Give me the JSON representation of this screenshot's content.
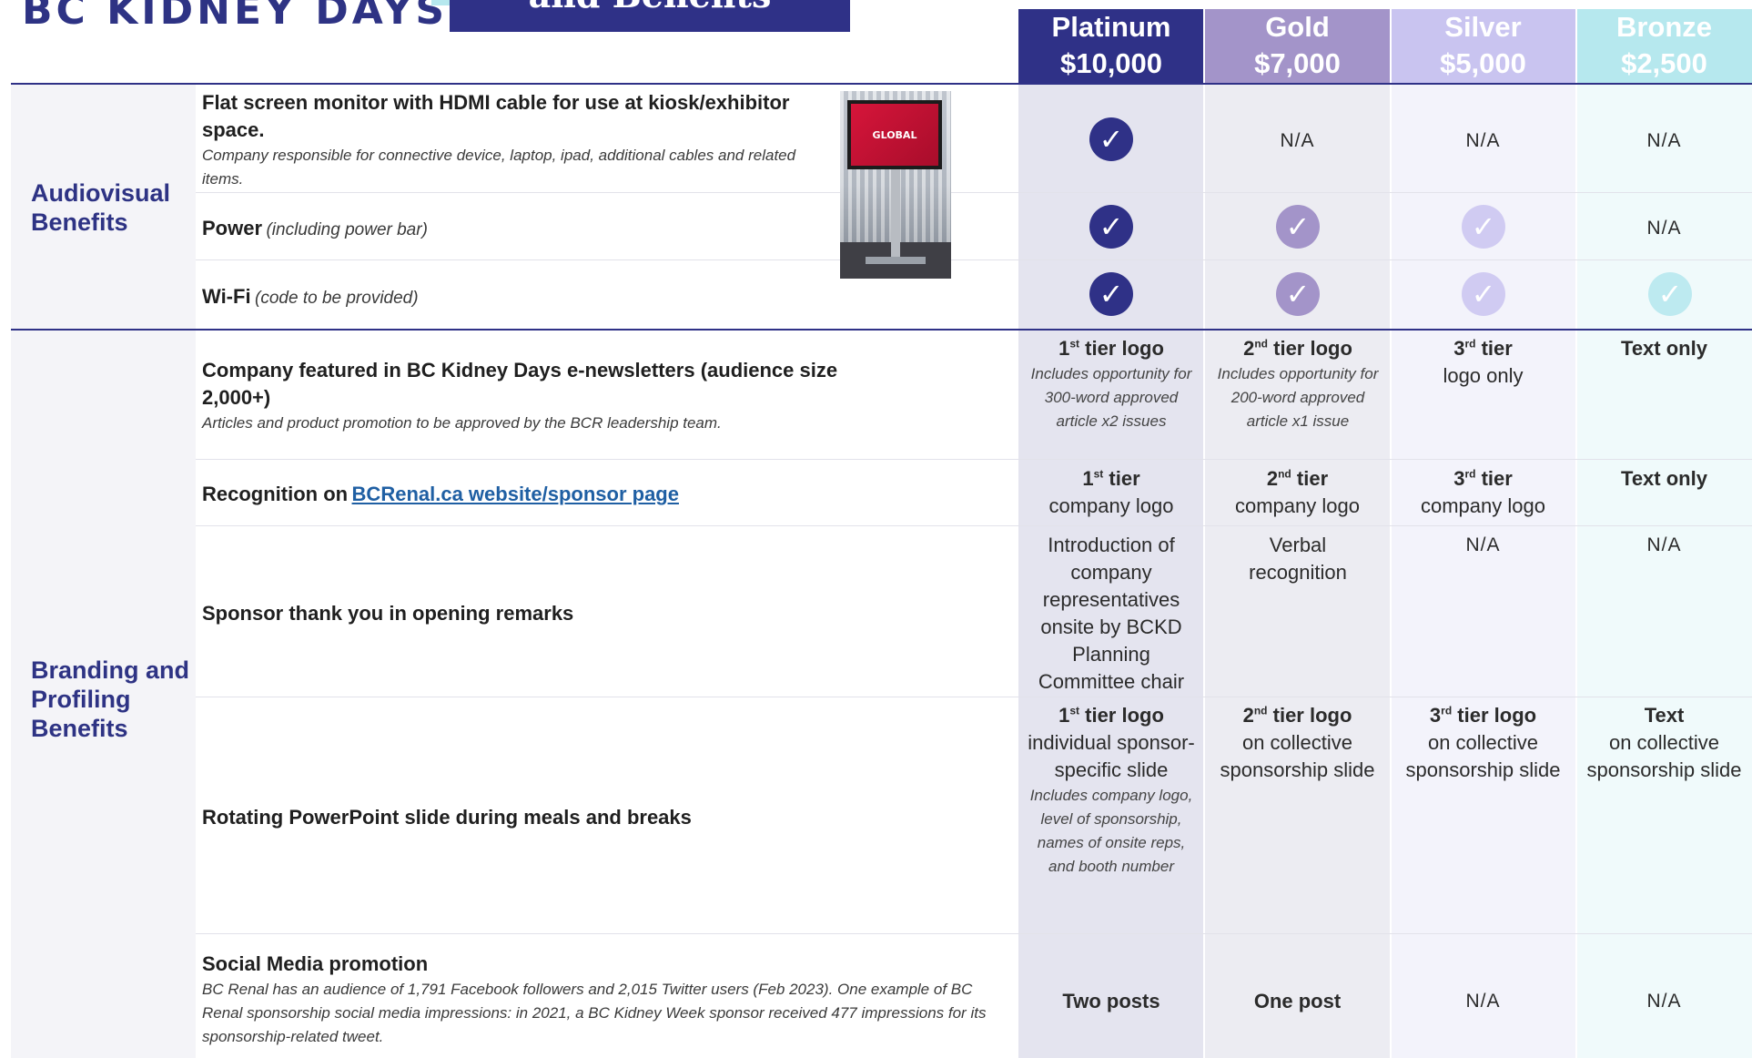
{
  "header": {
    "brand": "BC KIDNEY DAYS",
    "banner_fragment": "and Benefits"
  },
  "tiers": [
    {
      "name": "Platinum",
      "price": "$10,000",
      "header_color": "#2f3187",
      "column_color": "#e4e4ef"
    },
    {
      "name": "Gold",
      "price": "$7,000",
      "header_color": "#a394c9",
      "column_color": "#ececf2"
    },
    {
      "name": "Silver",
      "price": "$5,000",
      "header_color": "#c9c4f0",
      "column_color": "#f3f3fb"
    },
    {
      "name": "Bronze",
      "price": "$2,500",
      "header_color": "#b6e8ee",
      "column_color": "#f0fafb"
    }
  ],
  "check_colors": [
    "#2f3187",
    "#a394c9",
    "#d0cbf2",
    "#bdeaf0"
  ],
  "sections": {
    "audiovisual": "Audiovisual Benefits",
    "branding": "Branding and Profiling Benefits"
  },
  "photo": {
    "screen_text": "GLOBAL",
    "icon": "tv-monitor-photo"
  },
  "rows": {
    "monitor": {
      "title": "Flat screen monitor with HDMI cable for use at kiosk/exhibitor space.",
      "note": "Company responsible for connective device, laptop, ipad, additional cables and related items.",
      "gold": "N/A",
      "silver": "N/A",
      "bronze": "N/A"
    },
    "power": {
      "title": "Power",
      "note": "(including power bar)",
      "bronze": "N/A"
    },
    "wifi": {
      "title": "Wi-Fi",
      "note": "(code to be provided)"
    },
    "newsletter": {
      "title": "Company featured in BC Kidney Days e-newsletters (audience size 2,000+)",
      "note": "Articles and product promotion to be approved by the BCR leadership team.",
      "platinum": {
        "ord": "1",
        "sup": "st",
        "bold": "tier logo",
        "note": "Includes opportunity for 300-word approved article x2 issues"
      },
      "gold": {
        "ord": "2",
        "sup": "nd",
        "bold": "tier logo",
        "note": "Includes opportunity for 200-word approved article x1 issue"
      },
      "silver": {
        "ord": "3",
        "sup": "rd",
        "bold": "tier",
        "line": "logo only"
      },
      "bronze": {
        "bold": "Text only"
      }
    },
    "website": {
      "title_prefix": "Recognition on",
      "link": "BCRenal.ca website/sponsor page",
      "platinum": {
        "ord": "1",
        "sup": "st",
        "bold": "tier",
        "line": "company logo"
      },
      "gold": {
        "ord": "2",
        "sup": "nd",
        "bold": "tier",
        "line": "company logo"
      },
      "silver": {
        "ord": "3",
        "sup": "rd",
        "bold": "tier",
        "line": "company logo"
      },
      "bronze": {
        "bold": "Text only"
      }
    },
    "thanks": {
      "title": "Sponsor thank you in opening remarks",
      "platinum": "Introduction of company representatives onsite by BCKD Planning Committee chair",
      "gold": "Verbal recognition",
      "silver": "N/A",
      "bronze": "N/A"
    },
    "slides": {
      "title": "Rotating PowerPoint slide during meals and breaks",
      "platinum": {
        "ord": "1",
        "sup": "st",
        "bold": "tier logo",
        "line": "individual sponsor-specific slide",
        "note": "Includes company logo, level of sponsorship, names of onsite reps, and booth number"
      },
      "gold": {
        "ord": "2",
        "sup": "nd",
        "bold": "tier logo",
        "line": "on collective sponsorship slide"
      },
      "silver": {
        "ord": "3",
        "sup": "rd",
        "bold": "tier logo",
        "line": "on collective sponsorship slide"
      },
      "bronze": {
        "bold": "Text",
        "line": "on collective sponsorship slide"
      }
    },
    "social": {
      "title": "Social Media promotion",
      "note": "BC Renal has an audience of 1,791 Facebook followers and 2,015 Twitter users (Feb 2023). One example of BC Renal sponsorship social media impressions: in 2021, a BC Kidney Week sponsor received 477 impressions for its sponsorship-related tweet.",
      "platinum": "Two posts",
      "gold": "One post",
      "silver": "N/A",
      "bronze": "N/A"
    }
  }
}
